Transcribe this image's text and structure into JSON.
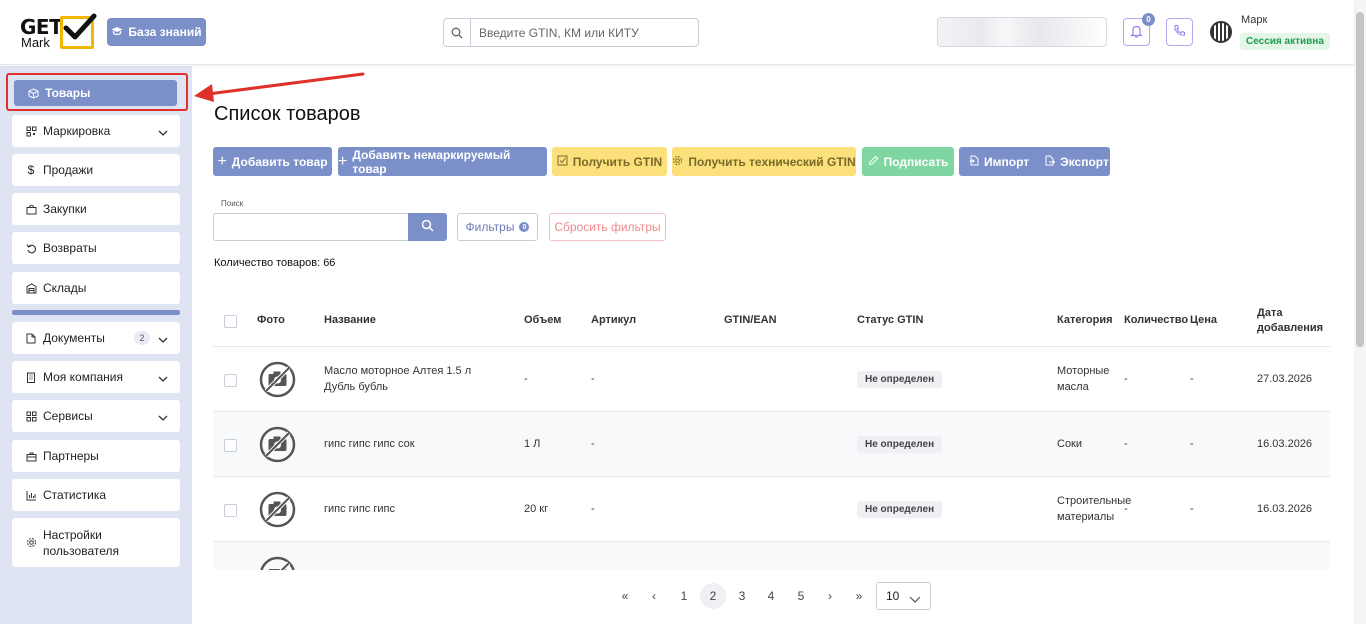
{
  "header": {
    "logo_get": "GET",
    "logo_mark": "Mark",
    "knowledge_base": "База знаний",
    "search_placeholder": "Введите GTIN, КМ или КИТУ",
    "notifications_count": "0",
    "user_name": "Марк",
    "session_status": "Сессия активна"
  },
  "sidebar": {
    "items": [
      {
        "label": "Товары"
      },
      {
        "label": "Маркировка"
      },
      {
        "label": "Продажи"
      },
      {
        "label": "Закупки"
      },
      {
        "label": "Возвраты"
      },
      {
        "label": "Склады"
      },
      {
        "label": "Документы",
        "badge": "2"
      },
      {
        "label": "Моя компания"
      },
      {
        "label": "Сервисы"
      },
      {
        "label": "Партнеры"
      },
      {
        "label": "Статистика"
      },
      {
        "label": "Настройки пользователя"
      }
    ]
  },
  "main": {
    "title": "Список товаров",
    "buttons": {
      "add_product": "Добавить товар",
      "add_unmarked": "Добавить немаркируемый товар",
      "get_gtin": "Получить GTIN",
      "get_tech_gtin": "Получить технический GTIN",
      "sign": "Подписать",
      "import": "Импорт",
      "export": "Экспорт"
    },
    "search_label": "Поиск",
    "filters": "Фильтры",
    "filters_count": "0",
    "reset_filters": "Сбросить фильтры",
    "count_label": "Количество товаров: 66"
  },
  "table": {
    "headers": {
      "photo": "Фото",
      "name": "Название",
      "volume": "Объем",
      "article": "Артикул",
      "gtin": "GTIN/EAN",
      "status": "Статус GTIN",
      "category": "Категория",
      "quantity": "Количество",
      "price": "Цена",
      "date_line1": "Дата",
      "date_line2": "добавления"
    },
    "rows": [
      {
        "name_line1": "Масло моторное Алтея 1.5 л",
        "name_line2": "Дубль бубль",
        "volume": "-",
        "article": "-",
        "gtin": "",
        "status": "Не определен",
        "category_line1": "Моторные",
        "category_line2": "масла",
        "quantity": "-",
        "price": "-",
        "date": "27.03.2026"
      },
      {
        "name_line1": "гипс гипс гипс сок",
        "name_line2": "",
        "volume": "1 Л",
        "article": "-",
        "gtin": "",
        "status": "Не определен",
        "category_line1": "Соки",
        "category_line2": "",
        "quantity": "-",
        "price": "-",
        "date": "16.03.2026"
      },
      {
        "name_line1": "гипс гипс гипс",
        "name_line2": "",
        "volume": "20 кг",
        "article": "-",
        "gtin": "",
        "status": "Не определен",
        "category_line1": "Строительные",
        "category_line2": "материалы",
        "quantity": "-",
        "price": "-",
        "date": "16.03.2026"
      }
    ]
  },
  "pagination": {
    "first": "«",
    "prev": "‹",
    "pages": [
      "1",
      "2",
      "3",
      "4",
      "5"
    ],
    "current": "2",
    "next": "›",
    "last": "»",
    "per_page": "10"
  },
  "colors": {
    "accent": "#7b8fc9",
    "sidebar_bg": "#dfe4f3",
    "yellow": "#fbe07b",
    "green": "#7fd6a0",
    "highlight_red": "#e0302a"
  }
}
